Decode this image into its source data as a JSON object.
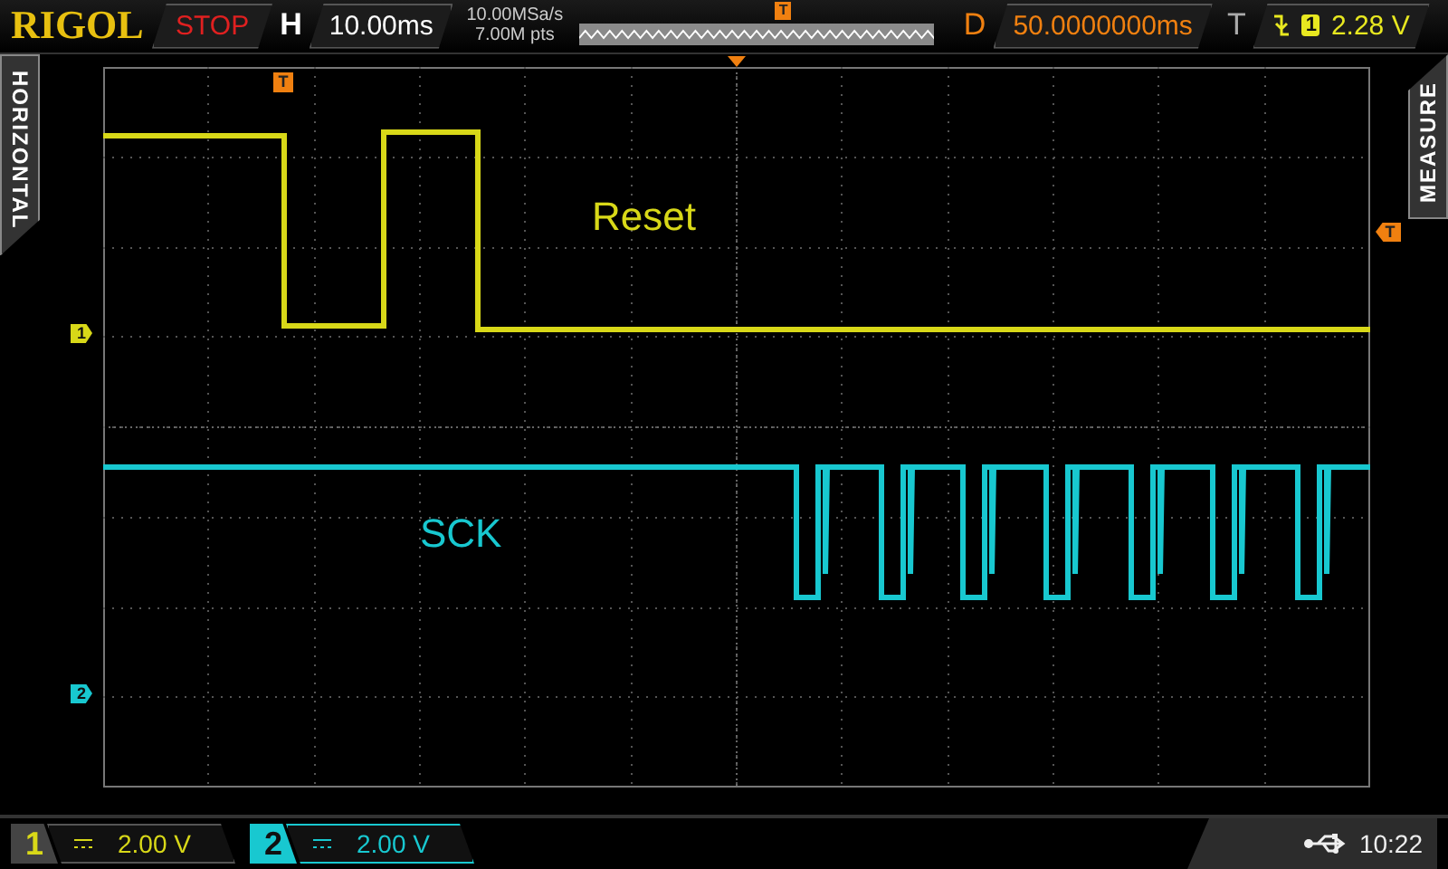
{
  "top_bar": {
    "logo": "RIGOL",
    "run_state": "STOP",
    "timebase_label": "H",
    "timebase": "10.00ms",
    "sample_rate": "10.00MSa/s",
    "memory_depth": "7.00M pts",
    "overview_trigger_marker": "T",
    "delay_label": "D",
    "delay": "50.0000000ms",
    "trigger_label": "T",
    "trigger_channel": "1",
    "trigger_level": "2.28 V"
  },
  "side_tabs": {
    "left": "HORIZONTAL",
    "right": "MEASURE"
  },
  "grid": {
    "trigger_position_marker": "T",
    "trigger_level_marker": "T"
  },
  "traces": [
    {
      "label": "Reset",
      "marker": "1",
      "color": "#d8d818",
      "kind": "reset"
    },
    {
      "label": "SCK",
      "marker": "2",
      "color": "#18c8d0",
      "kind": "clock"
    }
  ],
  "channels": [
    {
      "number": "1",
      "scale": "2.00 V",
      "selected": false,
      "color": "#d8d818"
    },
    {
      "number": "2",
      "scale": "2.00 V",
      "selected": true,
      "color": "#18c8d0"
    }
  ],
  "status": {
    "clock": "10:22"
  }
}
